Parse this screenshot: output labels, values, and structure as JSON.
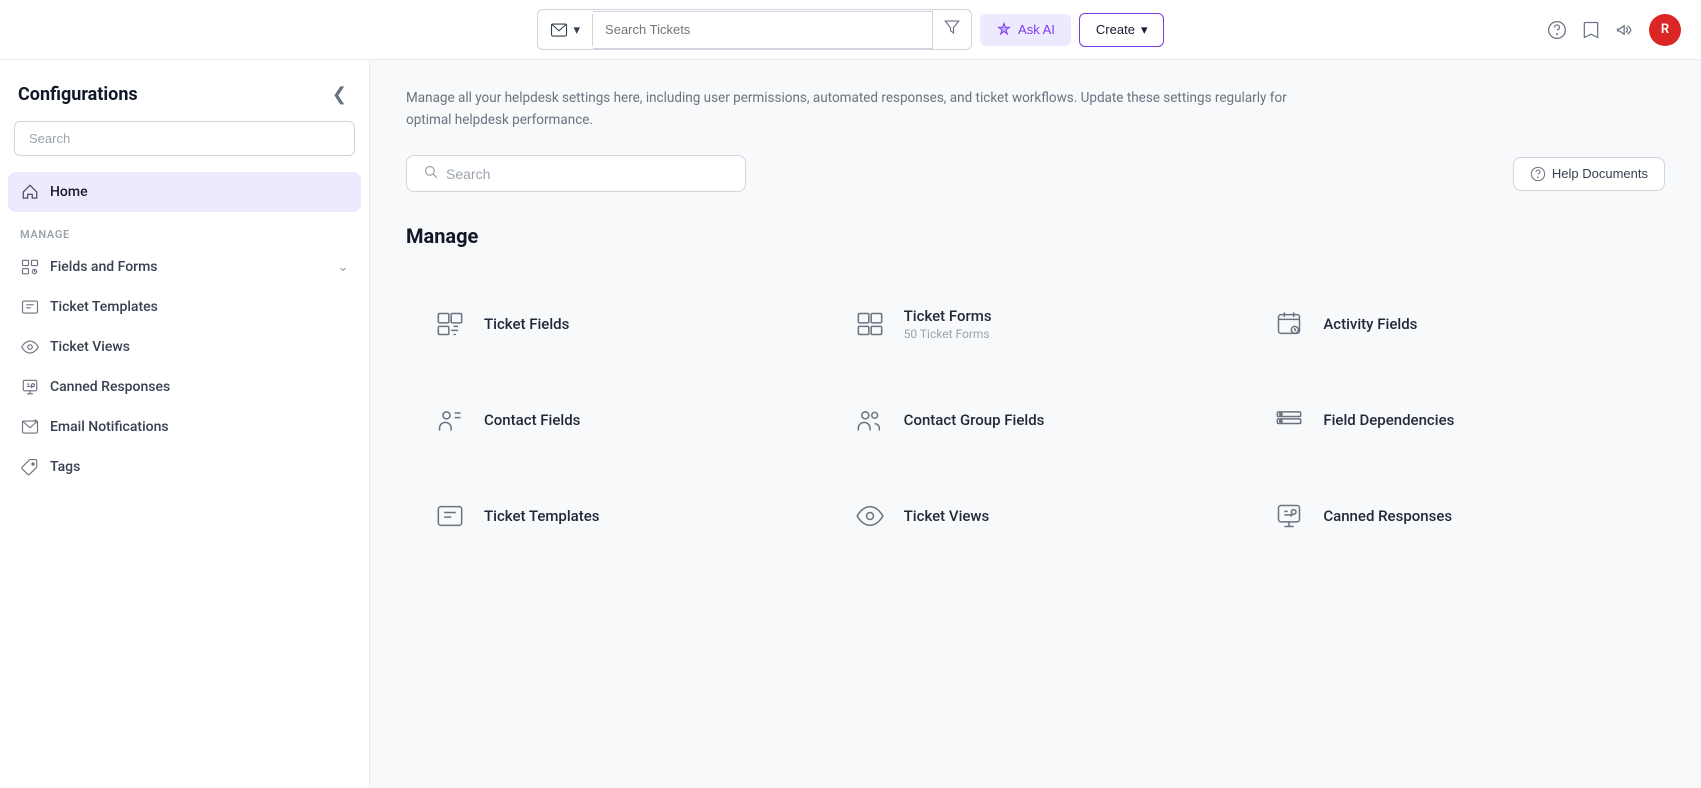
{
  "header": {
    "ticket_type_label": "✉",
    "ticket_type_dropdown": "▾",
    "search_placeholder": "Search Tickets",
    "filter_icon": "⊟",
    "ask_ai_label": "Ask AI",
    "create_label": "Create",
    "create_dropdown": "▾",
    "help_icon": "?",
    "bookmark_icon": "🔖",
    "announce_icon": "📢",
    "avatar_initials": "R"
  },
  "sidebar": {
    "title": "Configurations",
    "collapse_icon": "❮",
    "search_placeholder": "Search",
    "nav_section": "MANAGE",
    "items": [
      {
        "id": "home",
        "label": "Home",
        "active": true
      },
      {
        "id": "fields-and-forms",
        "label": "Fields and Forms",
        "has_chevron": true
      },
      {
        "id": "ticket-templates",
        "label": "Ticket Templates"
      },
      {
        "id": "ticket-views",
        "label": "Ticket Views"
      },
      {
        "id": "canned-responses",
        "label": "Canned Responses"
      },
      {
        "id": "email-notifications",
        "label": "Email Notifications"
      },
      {
        "id": "tags",
        "label": "Tags"
      }
    ]
  },
  "main": {
    "description": "Manage all your helpdesk settings here, including user permissions, automated responses, and ticket workflows. Update these settings regularly for optimal helpdesk performance.",
    "search_placeholder": "Search",
    "help_docs_label": "Help Documents",
    "section_title": "Manage",
    "grid_items": [
      {
        "id": "ticket-fields",
        "label": "Ticket Fields",
        "sublabel": ""
      },
      {
        "id": "ticket-forms",
        "label": "Ticket Forms",
        "sublabel": "50 Ticket Forms"
      },
      {
        "id": "activity-fields",
        "label": "Activity Fields",
        "sublabel": ""
      },
      {
        "id": "contact-fields",
        "label": "Contact Fields",
        "sublabel": ""
      },
      {
        "id": "contact-group-fields",
        "label": "Contact Group Fields",
        "sublabel": ""
      },
      {
        "id": "field-dependencies",
        "label": "Field Dependencies",
        "sublabel": ""
      },
      {
        "id": "ticket-templates",
        "label": "Ticket Templates",
        "sublabel": ""
      },
      {
        "id": "ticket-views",
        "label": "Ticket Views",
        "sublabel": ""
      },
      {
        "id": "canned-responses",
        "label": "Canned Responses",
        "sublabel": ""
      }
    ]
  }
}
